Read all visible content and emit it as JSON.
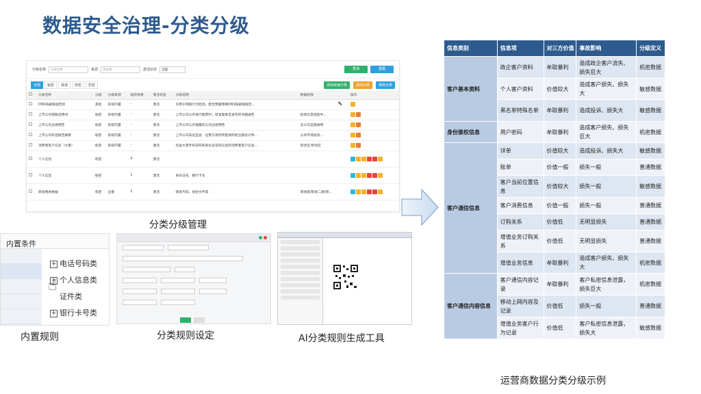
{
  "page_title": "数据安全治理-分类分级",
  "admin": {
    "filters": [
      {
        "label": "分级名称",
        "placeholder": "分级名称"
      },
      {
        "label": "来源",
        "placeholder": "请选择"
      },
      {
        "label": "激活状态",
        "value": "全部"
      }
    ],
    "query_btn": "查询",
    "reset_btn": "重置",
    "tabs": [
      "全部",
      "秘密",
      "其他",
      "商密",
      "机密"
    ],
    "actions": [
      "添加快速分类",
      "添加分类",
      "规则分类"
    ],
    "columns": [
      "分级名称",
      "分级",
      "分级来源",
      "规则条数",
      "激活状态",
      "分级说明",
      "数据权限",
      "操作"
    ],
    "rows": [
      {
        "name": "DNS隐蔽隧道检测",
        "level": "其他",
        "source": "系统内置",
        "count": "-",
        "status": "激活",
        "desc": "仅用于网络行为检测，配合预置策略DNS隐蔽隧道检...",
        "perm": "",
        "tall": false
      },
      {
        "name": "上市公司观股说明书",
        "level": "秘密",
        "source": "系统内置",
        "count": "-",
        "status": "激活",
        "desc": "上市公司公开发行股票时，就该股事宜发布的书面通告",
        "perm": "投资信息调查中...",
        "tall": false
      },
      {
        "name": "上市公司业绩预告",
        "level": "秘密",
        "source": "系统内置",
        "count": "-",
        "status": "激活",
        "desc": "上市公司公开披露的公司业绩预告",
        "perm": "全公司全部通用",
        "tall": false
      },
      {
        "name": "上市公司年度报告摘要",
        "level": "秘密",
        "source": "系统内置",
        "count": "-",
        "status": "激活",
        "desc": "上市公司向证监会、证券交易所所提供的经注册会计师...",
        "perm": "公共市场投资...",
        "tall": false
      },
      {
        "name": "消费者客户信息（大量）",
        "level": "机密",
        "source": "系统内置",
        "count": "-",
        "status": "激活",
        "desc": "包含大量手机号码和身份证号码信息的消费者客户信息...",
        "perm": "综合区/综合区",
        "tall": false
      },
      {
        "name": "个人信息",
        "level": "机密",
        "source": "",
        "count": "4",
        "status": "激活",
        "desc": "",
        "perm": "",
        "tall": true
      },
      {
        "name": "个人信息",
        "level": "秘密",
        "source": "",
        "count": "1",
        "status": "激活",
        "desc": "身份证号、银行卡号",
        "perm": "",
        "tall": true
      },
      {
        "name": "研发相关数据",
        "level": "机密",
        "source": "全部",
        "count": "2",
        "status": "激活",
        "desc": "研发代码、加密文件等",
        "perm": "研发部/研发二部/研...",
        "tall": true
      }
    ]
  },
  "captions": {
    "admin": "分类分级管理",
    "rules": "内置规则",
    "setting": "分类规则设定",
    "ai": "AI分类规则生成工具",
    "table": "运营商数据分类分级示例"
  },
  "rules_panel": {
    "header": "内置条件",
    "items": [
      "电话号码类",
      "个人信息类",
      "证件类",
      "银行卡号类"
    ]
  },
  "ops_table": {
    "headers": [
      "信息类别",
      "信息项",
      "对三方价值",
      "事故影响",
      "分级定义"
    ],
    "groups": [
      {
        "category": "客户基本资料",
        "rows": [
          [
            "政企客户资料",
            "牟取暴利",
            "造成政企客户流失、损失巨大",
            "机密数据"
          ],
          [
            "个人客户资料",
            "价值较大",
            "造成客户损失、损失大",
            "敏感数据"
          ],
          [
            "黑名单特殊名单",
            "牟取暴利",
            "造成投诉、损失大",
            "敏感数据"
          ]
        ]
      },
      {
        "category": "身份鉴权信息",
        "rows": [
          [
            "用户密码",
            "牟取暴利",
            "造成客户损失、损失巨大",
            "机密数据"
          ]
        ]
      },
      {
        "category": "客户通信信息",
        "rows": [
          [
            "详单",
            "价值较大",
            "造成投诉、损失大",
            "敏感数据"
          ],
          [
            "账单",
            "价值一般",
            "损失一般",
            "普通数据"
          ],
          [
            "客户当前位置信息",
            "价值较大",
            "损失一般",
            "敏感数据"
          ],
          [
            "客户消费信息",
            "价值一般",
            "损失一般",
            "普通数据"
          ],
          [
            "订购关系",
            "价值低",
            "无明显损失",
            "普通数据"
          ],
          [
            "增值业务订购关系",
            "价值低",
            "无明显损失",
            "普通数据"
          ],
          [
            "增值业务信息",
            "牟取暴利",
            "造成客户损失、损失大",
            "机密数据"
          ]
        ]
      },
      {
        "category": "客户通信内容信息",
        "rows": [
          [
            "客户通信内容记录",
            "牟取暴利",
            "客户私密信息泄露，损失巨大",
            "机密数据"
          ],
          [
            "移动上网内容及记录",
            "价值低",
            "损失一般",
            "普通数据"
          ],
          [
            "增值业务客户行为记录",
            "价值低",
            "客户私密信息泄露，损失大",
            "敏感数据"
          ]
        ]
      }
    ]
  },
  "colors": {
    "title": "#2d5b8e",
    "header_bg": "#2d5b8e",
    "category_bg": "#b9cbe3",
    "green_btn": "#2fb16b",
    "blue_btn": "#2e9fdf",
    "orange_btn": "#f0a22e"
  }
}
